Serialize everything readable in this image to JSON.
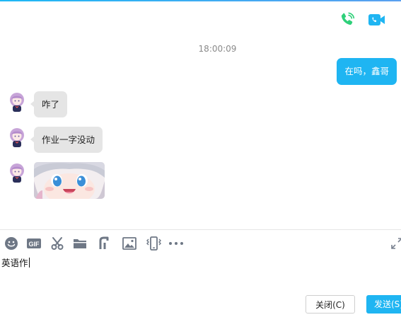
{
  "header": {
    "voice_call_icon": "phone-icon",
    "video_call_icon": "video-call-icon",
    "accent_color": "#1fb5f2",
    "phone_color": "#2fd07a"
  },
  "messages": {
    "timestamp": "18:00:09",
    "outgoing": [
      {
        "text": "在吗，鑫哥"
      }
    ],
    "incoming": [
      {
        "type": "text",
        "text": "咋了"
      },
      {
        "type": "text",
        "text": "作业一字没动"
      },
      {
        "type": "sticker",
        "text": ""
      }
    ]
  },
  "toolbar": {
    "tools": [
      "emoji-icon",
      "gif-icon",
      "scissors-icon",
      "folder-icon",
      "music-icon",
      "image-icon",
      "shake-icon",
      "more-icon"
    ],
    "gif_label": "GIF",
    "expand_icon": "expand-icon"
  },
  "input": {
    "value": "英语作"
  },
  "footer": {
    "close_label": "关闭(C)",
    "send_label": "发送(S)"
  }
}
